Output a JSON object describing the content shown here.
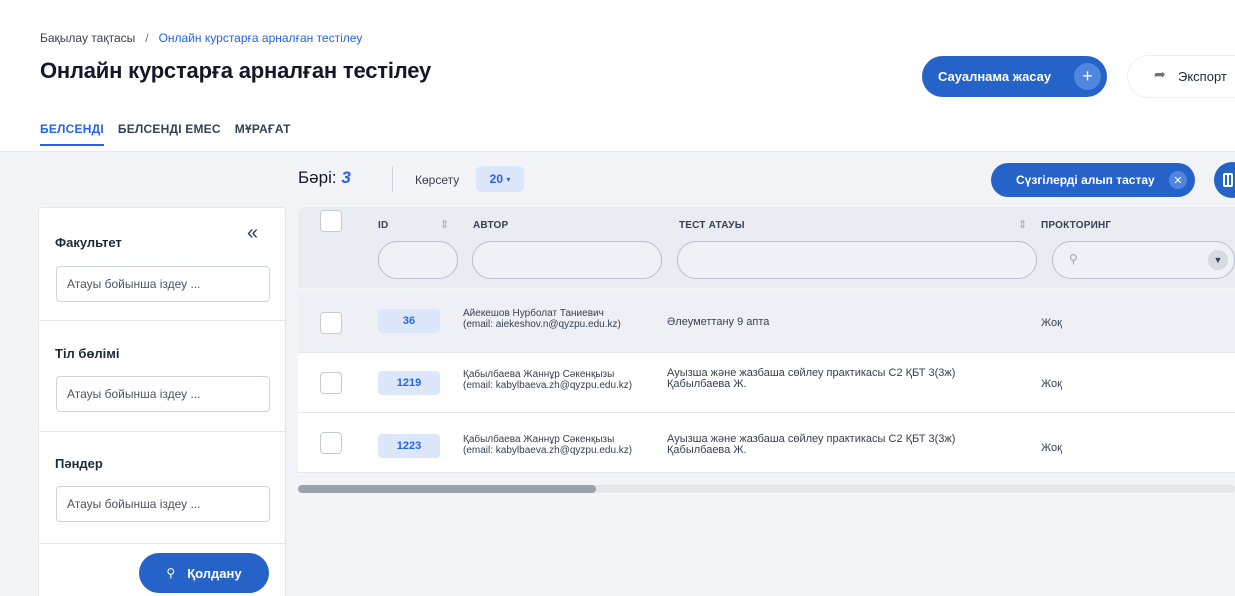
{
  "breadcrumb": {
    "home": "Бақылау тақтасы",
    "separator": "/",
    "current": "Онлайн курстарға арналған тестілеу"
  },
  "page_title": "Онлайн курстарға арналған тестілеу",
  "actions": {
    "create_label": "Сауалнама жасау",
    "create_icon": "plus-icon",
    "export_label": "Экспорт"
  },
  "tabs": [
    {
      "label": "БЕЛСЕНДІ",
      "active": true
    },
    {
      "label": "БЕЛСЕНДІ ЕМЕС",
      "active": false
    },
    {
      "label": "МҰРАҒАТ",
      "active": false
    }
  ],
  "toolbar": {
    "total_label": "Бәрі:",
    "total_count": "3",
    "show_label": "Көрсету",
    "page_size": "20",
    "clear_filters_label": "Сүзгілерді алып тастау"
  },
  "filters": {
    "sections": [
      {
        "title": "Факультет",
        "placeholder": "Атауы бойынша іздеу ..."
      },
      {
        "title": "Тіл бөлімі",
        "placeholder": "Атауы бойынша іздеу ..."
      },
      {
        "title": "Пәндер",
        "placeholder": "Атауы бойынша іздеу ..."
      }
    ],
    "apply_label": "Қолдану"
  },
  "table": {
    "columns": {
      "id": "ID",
      "author": "АВТОР",
      "test_name": "ТЕСТ АТАУЫ",
      "proctoring": "ПРОКТОРИНГ"
    },
    "rows": [
      {
        "id": "36",
        "author_name": "Айекешов Нурболат Таниевич",
        "author_email": "(email: aiekeshov.n@qyzpu.edu.kz)",
        "test_line1": "Әлеуметтану 9 апта",
        "test_line2": "",
        "proctoring": "Жоқ"
      },
      {
        "id": "1219",
        "author_name": "Қабылбаева Жаннұр Сәкенқызы",
        "author_email": "(email: kabylbaeva.zh@qyzpu.edu.kz)",
        "test_line1": "Ауызша және жазбаша сөйлеу практикасы С2 ҚБТ 3(3ж)",
        "test_line2": "Қабылбаева Ж.",
        "proctoring": "Жоқ"
      },
      {
        "id": "1223",
        "author_name": "Қабылбаева Жаннұр Сәкенқызы",
        "author_email": "(email: kabylbaeva.zh@qyzpu.edu.kz)",
        "test_line1": "Ауызша және жазбаша сөйлеу практикасы С2 ҚБТ 3(3ж)",
        "test_line2": "Қабылбаева Ж.",
        "proctoring": "Жоқ"
      }
    ]
  },
  "colors": {
    "accent": "#2563c9",
    "link": "#2563eb",
    "badge_bg": "#dce7fb",
    "page_bg": "#f3f4f8"
  }
}
